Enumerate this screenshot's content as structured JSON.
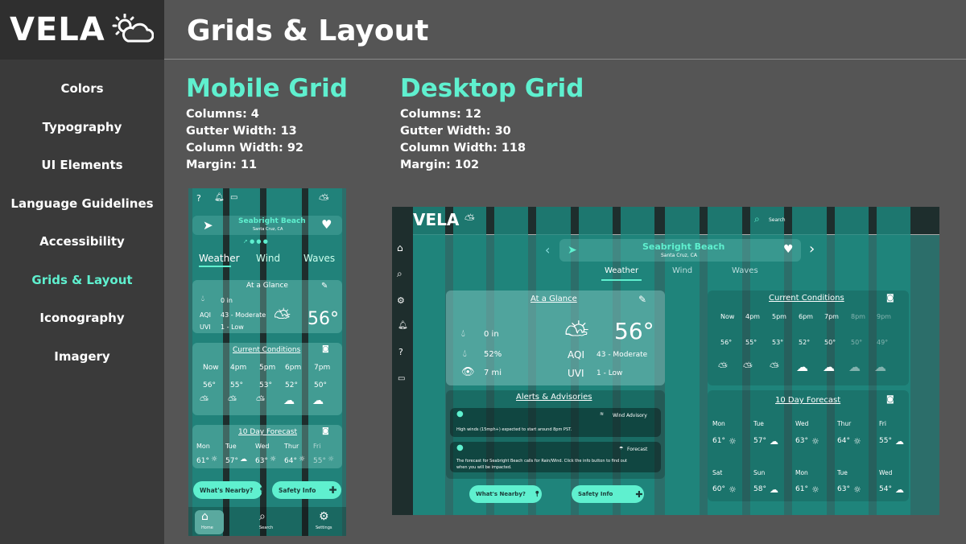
{
  "brand": {
    "name": "VELA",
    "logo_icon": "sun-cloud-icon"
  },
  "nav": {
    "items": [
      {
        "label": "Colors",
        "active": false
      },
      {
        "label": "Typography",
        "active": false
      },
      {
        "label": "UI Elements",
        "active": false
      },
      {
        "label": "Language Guidelines",
        "active": false
      },
      {
        "label": "Accessibility",
        "active": false
      },
      {
        "label": "Grids & Layout",
        "active": true
      },
      {
        "label": "Iconography",
        "active": false
      },
      {
        "label": "Imagery",
        "active": false
      }
    ]
  },
  "page": {
    "title": "Grids & Layout"
  },
  "mobile_grid": {
    "heading": "Mobile Grid",
    "columns": "Columns: 4",
    "gutter": "Gutter Width: 13",
    "column_width": "Column Width: 92",
    "margin": "Margin: 11"
  },
  "desktop_grid": {
    "heading": "Desktop Grid",
    "columns": "Columns: 12",
    "gutter": "Gutter Width: 30",
    "column_width": "Column Width: 118",
    "margin": "Margin: 102"
  },
  "mobile": {
    "location": "Seabright Beach",
    "sublocation": "Santa Cruz, CA",
    "tabs": [
      "Weather",
      "Wind",
      "Waves"
    ],
    "glance": {
      "title": "At a Glance",
      "rain": "0 in",
      "aqi_label": "AQI",
      "aqi": "43 - Moderate",
      "uvi_label": "UVI",
      "uvi": "1 - Low",
      "temp": "56°"
    },
    "conditions": {
      "title": "Current Conditions",
      "times": [
        "Now",
        "4pm",
        "5pm",
        "6pm",
        "7pm"
      ],
      "temps": [
        "56°",
        "55°",
        "53°",
        "52°",
        "50°"
      ]
    },
    "forecast": {
      "title": "10 Day Forecast",
      "days": [
        "Mon",
        "Tue",
        "Wed",
        "Thur",
        "Fri"
      ],
      "temps": [
        "61°",
        "57°",
        "63°",
        "64°",
        "55°"
      ]
    },
    "buttons": {
      "nearby": "What's Nearby?",
      "safety": "Safety Info"
    },
    "bottom_nav": [
      "Home",
      "Search",
      "Settings"
    ]
  },
  "desktop": {
    "brand": "VELA",
    "search_placeholder": "Search",
    "location": "Seabright Beach",
    "sublocation": "Santa Cruz, CA",
    "tabs": [
      "Weather",
      "Wind",
      "Waves"
    ],
    "glance": {
      "title": "At a Glance",
      "rain": "0 in",
      "humidity": "52%",
      "visibility": "7 mi",
      "aqi_label": "AQI",
      "aqi": "43 - Moderate",
      "uvi_label": "UVI",
      "uvi": "1 - Low",
      "temp": "56°"
    },
    "alerts": {
      "title": "Alerts & Advisories",
      "items": [
        {
          "tag": "Wind Advisory",
          "text": "High winds (15mph+) expected to start around 8pm PST."
        },
        {
          "tag": "Forecast",
          "text": "The forecast for Seabright Beach calls for Rain/Wind. Click the info button to find out",
          "text2": "when you will be impacted."
        }
      ]
    },
    "buttons": {
      "nearby": "What's Nearby?",
      "safety": "Safety Info"
    },
    "conditions": {
      "title": "Current Conditions",
      "times": [
        "Now",
        "4pm",
        "5pm",
        "6pm",
        "7pm",
        "8pm",
        "9pm"
      ],
      "temps": [
        "56°",
        "55°",
        "53°",
        "52°",
        "50°",
        "50°",
        "49°"
      ]
    },
    "forecast": {
      "title": "10 Day Forecast",
      "row1_days": [
        "Mon",
        "Tue",
        "Wed",
        "Thur",
        "Fri"
      ],
      "row1_temps": [
        "61°",
        "57°",
        "63°",
        "64°",
        "55°"
      ],
      "row2_days": [
        "Sat",
        "Sun",
        "Mon",
        "Tue",
        "Wed"
      ],
      "row2_temps": [
        "60°",
        "58°",
        "61°",
        "63°",
        "54°"
      ]
    }
  },
  "colors": {
    "accent": "#5ff0cf",
    "sidebar": "#3a3a3a",
    "background": "#555555",
    "grid_column": "#1d8a80"
  }
}
